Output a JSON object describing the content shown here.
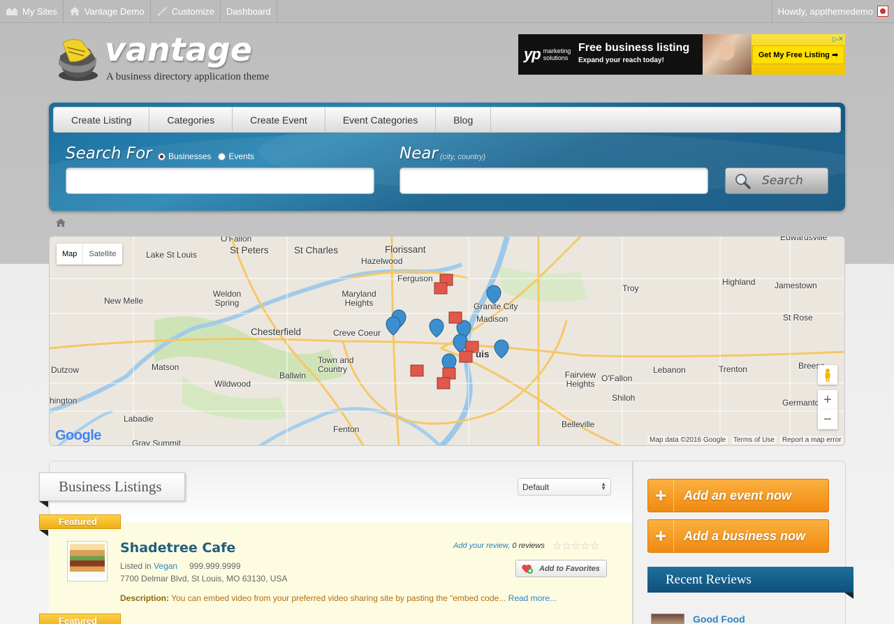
{
  "admin_bar": {
    "my_sites": "My Sites",
    "site_name": "Vantage Demo",
    "customize": "Customize",
    "dashboard": "Dashboard",
    "greeting": "Howdy, appthemedemo"
  },
  "header": {
    "title": "vantage",
    "tagline": "A business directory application theme"
  },
  "ad": {
    "brand": "yp",
    "brand_sub": "marketing solutions",
    "headline": "Free business listing",
    "subline": "Expand your reach today!",
    "cta": "Get My Free Listing ➡"
  },
  "nav": {
    "items": [
      "Create Listing",
      "Categories",
      "Create Event",
      "Event Categories",
      "Blog"
    ]
  },
  "search": {
    "search_for": "Search For",
    "opt_businesses": "Businesses",
    "opt_events": "Events",
    "near": "Near",
    "near_hint": "(city, country)",
    "button": "Search",
    "query_value": "",
    "location_value": ""
  },
  "map": {
    "type_map": "Map",
    "type_satellite": "Satellite",
    "labels": [
      "St Peters",
      "St Charles",
      "Florissant",
      "Lake St Louis",
      "Hazelwood",
      "O'Fallon",
      "Ferguson",
      "Maryland Heights",
      "Weldon Spring",
      "New Melle",
      "Chesterfield",
      "Creve Coeur",
      "Granite City",
      "Madison",
      "Troy",
      "Highland",
      "Jamestown",
      "St Rose",
      "Town and Country",
      "Ballwin",
      "Wildwood",
      "Matson",
      "Dutzow",
      "Labadie",
      "Fenton",
      "Gray Summit",
      "Belleville",
      "Fairview Heights",
      "O'Fallon",
      "Shiloh",
      "Lebanon",
      "Trenton",
      "Breese",
      "Germantow",
      "hington",
      "Edwardsville",
      "uis"
    ],
    "attribution": "Map data ©2016 Google",
    "terms": "Terms of Use",
    "report": "Report a map error",
    "google": "Google"
  },
  "listings": {
    "heading": "Business Listings",
    "sort_value": "Default",
    "featured_label": "Featured",
    "item": {
      "title": "Shadetree Cafe",
      "listed_in": "Listed in",
      "category": "Vegan",
      "phone": "999.999.9999",
      "address": "7700 Delmar Blvd, St Louis, MO 63130, USA",
      "desc_label": "Description:",
      "desc": "You can embed video from your preferred video sharing site by pasting the “embed code...",
      "read_more": "Read more...",
      "add_review": "Add your review,",
      "reviews": "0 reviews",
      "favorites": "Add to Favorites"
    }
  },
  "sidebar": {
    "add_event": "Add an event now",
    "add_business": "Add a business now",
    "recent_reviews": "Recent Reviews",
    "review_title": "Good Food"
  },
  "colors": {
    "accent_blue": "#15608c",
    "orange": "#f08a12",
    "featured": "#f1ad12",
    "link": "#2d84c1"
  }
}
